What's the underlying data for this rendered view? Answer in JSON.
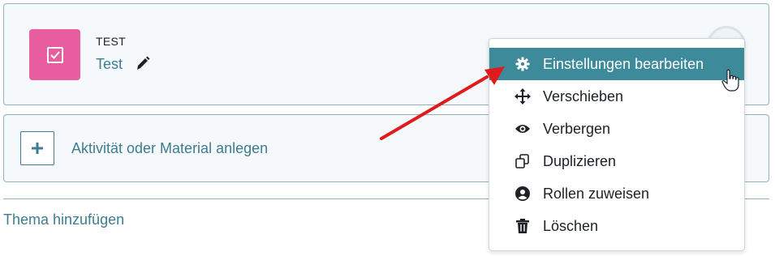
{
  "activity": {
    "type": "TEST",
    "name": "Test"
  },
  "add_activity": {
    "label": "Aktivität oder Material anlegen"
  },
  "add_section": {
    "label": "Thema hinzufügen"
  },
  "menu": {
    "items": [
      {
        "label": "Einstellungen bearbeiten",
        "icon": "gear-icon"
      },
      {
        "label": "Verschieben",
        "icon": "move-icon"
      },
      {
        "label": "Verbergen",
        "icon": "eye-icon"
      },
      {
        "label": "Duplizieren",
        "icon": "duplicate-icon"
      },
      {
        "label": "Rollen zuweisen",
        "icon": "user-circle-icon"
      },
      {
        "label": "Löschen",
        "icon": "trash-icon"
      }
    ]
  },
  "colors": {
    "accent": "#3d8a9b",
    "activity_icon_bg": "#e85d9f",
    "annotation_arrow": "#e01b1b"
  }
}
